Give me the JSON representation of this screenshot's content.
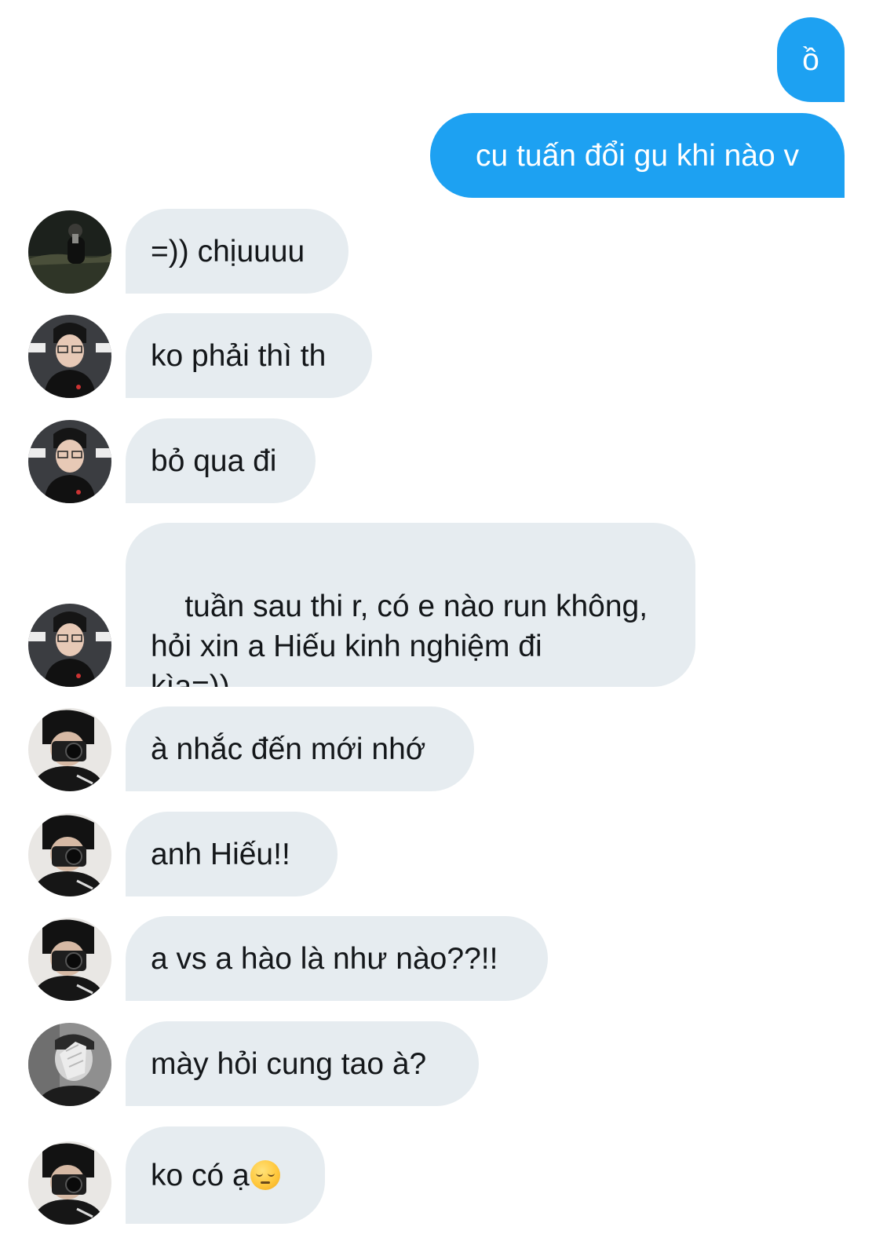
{
  "messages": [
    {
      "side": "outgoing",
      "text": "ồ"
    },
    {
      "side": "outgoing",
      "text": "cu tuấn đổi gu khi nào v"
    },
    {
      "side": "incoming",
      "avatar": "avatar-night-photo",
      "text": "=)) chịuuuu"
    },
    {
      "side": "incoming",
      "avatar": "avatar-smiling-glasses",
      "text": "ko phải thì th"
    },
    {
      "side": "incoming",
      "avatar": "avatar-smiling-glasses",
      "text": "bỏ qua đi"
    },
    {
      "side": "incoming",
      "avatar": "avatar-smiling-glasses",
      "text": "tuần sau thi r, có e nào run không,\nhỏi xin a Hiếu kinh nghiệm đi\nkìa=))"
    },
    {
      "side": "incoming",
      "avatar": "avatar-camera",
      "text": "à nhắc đến mới nhớ"
    },
    {
      "side": "incoming",
      "avatar": "avatar-camera",
      "text": "anh Hiếu!!"
    },
    {
      "side": "incoming",
      "avatar": "avatar-camera",
      "text": "a vs a hào là như nào??!!"
    },
    {
      "side": "incoming",
      "avatar": "avatar-hand-face",
      "text": "mày hỏi cung tao à?"
    },
    {
      "side": "incoming",
      "avatar": "avatar-camera",
      "text": "ko có ạ",
      "emoji": "pensive-face-emoji"
    }
  ],
  "colors": {
    "outgoing_bubble": "#1da1f2",
    "incoming_bubble": "#e6ecf0",
    "incoming_text": "#14171a",
    "outgoing_text": "#ffffff"
  }
}
